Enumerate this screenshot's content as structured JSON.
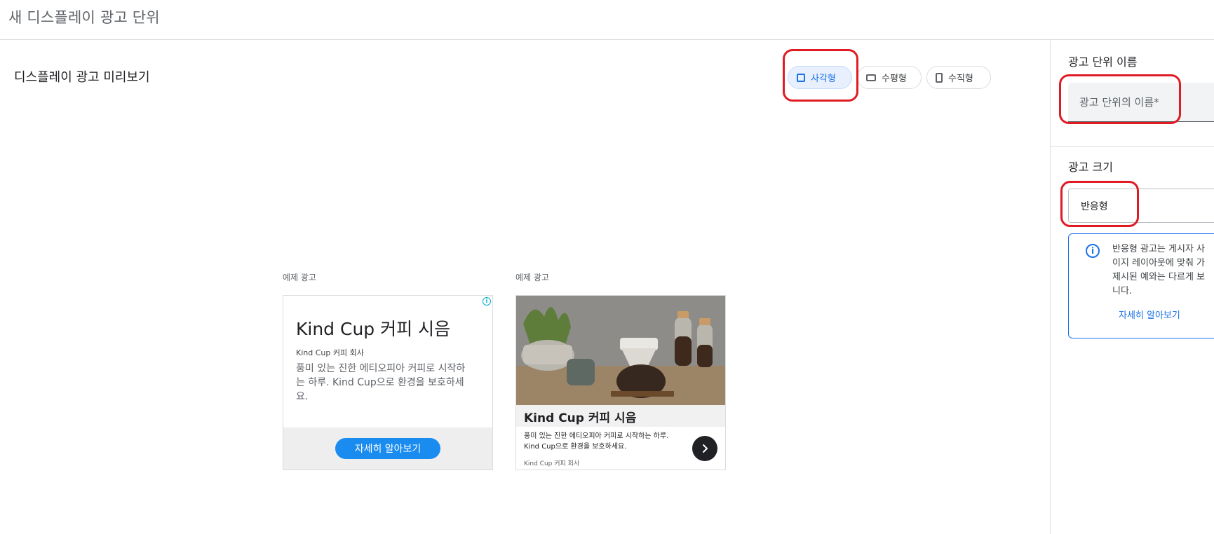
{
  "header": {
    "title": "새 디스플레이 광고 단위"
  },
  "preview": {
    "title": "디스플레이 광고 미리보기",
    "format_chips": [
      {
        "label": "사각형",
        "icon": "square-icon",
        "selected": true
      },
      {
        "label": "수평형",
        "icon": "horizontal-rect-icon",
        "selected": false
      },
      {
        "label": "수직형",
        "icon": "vertical-rect-icon",
        "selected": false
      }
    ],
    "ads": [
      {
        "label": "예제 광고",
        "headline": "Kind Cup 커피 시음",
        "company": "Kind Cup 커피 회사",
        "description": "풍미 있는 진한 에티오피아 커피로 시작하는 하루. Kind Cup으로 환경을 보호하세요.",
        "cta": "자세히 알아보기",
        "adchoices_icon": "adchoices-icon"
      },
      {
        "label": "예제 광고",
        "headline": "Kind Cup 커피 시음",
        "description": "풍미 있는 진한 에티오피아 커피로 시작하는 하루. Kind Cup으로 환경을 보호하세요.",
        "company": "Kind Cup 커피 회사",
        "next_icon": "chevron-right-icon",
        "image": "coffee-photo"
      }
    ]
  },
  "panel": {
    "name_section": {
      "title": "광고 단위 이름",
      "placeholder": "광고 단위의 이름*"
    },
    "size_section": {
      "title": "광고 크기",
      "selected": "반응형",
      "info_lines": [
        "반응형 광고는 게시자 사",
        "이지 레이아웃에 맞춰 가",
        "제시된 예와는 다르게 보",
        "니다."
      ],
      "info_link": "자세히 알아보기",
      "info_icon": "info-icon"
    }
  },
  "colors": {
    "accent": "#1a73e8",
    "highlight": "#e01b24",
    "cta": "#1a8cf0"
  }
}
